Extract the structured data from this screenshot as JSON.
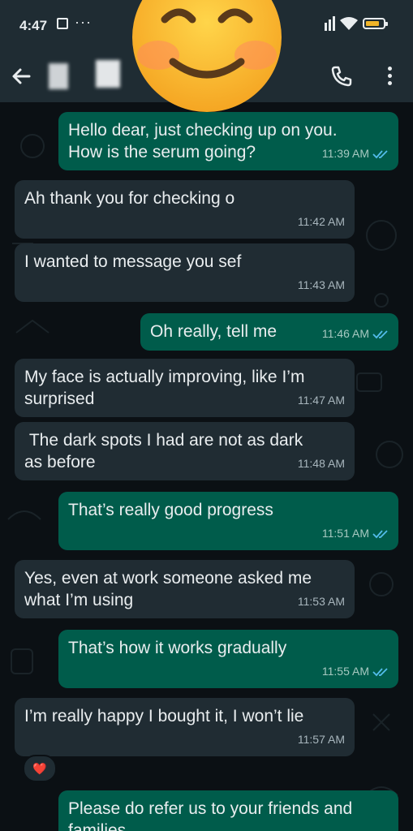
{
  "status_bar": {
    "time": "4:47",
    "dots": "···",
    "battery_level": 0.8,
    "battery_color": "#f0b429"
  },
  "header": {
    "back_icon": "arrow-left-icon",
    "call_icon": "phone-icon",
    "menu_icon": "more-vert-icon"
  },
  "colors": {
    "outgoing_bubble": "#005c4b",
    "incoming_bubble": "#202c33",
    "background": "#0b1014",
    "read_ticks": "#53bdeb"
  },
  "messages": [
    {
      "direction": "out",
      "text": "Hello dear, just checking up on you.\nHow is the serum going?",
      "time": "11:39 AM",
      "read": true
    },
    {
      "direction": "in",
      "text": "Ah thank you for checking o",
      "time": "11:42 AM"
    },
    {
      "direction": "in",
      "text": "I wanted to message you sef",
      "time": "11:43 AM"
    },
    {
      "direction": "out",
      "text": "Oh really, tell me",
      "time": "11:46 AM",
      "read": true
    },
    {
      "direction": "in",
      "text": "My face is actually improving, like I’m\nsurprised",
      "time": "11:47 AM"
    },
    {
      "direction": "in",
      "text": " The dark spots I had are not as dark\nas before",
      "time": "11:48 AM"
    },
    {
      "direction": "out",
      "text": "That’s really good progress",
      "time": "11:51 AM",
      "read": true
    },
    {
      "direction": "in",
      "text": "Yes, even at work someone asked me\nwhat I’m using",
      "time": "11:53 AM"
    },
    {
      "direction": "out",
      "text": "That’s how it works gradually",
      "time": "11:55 AM",
      "read": true
    },
    {
      "direction": "in",
      "text": "I’m really happy I bought it, I won’t lie",
      "time": "11:57 AM",
      "reaction": "❤️"
    },
    {
      "direction": "out",
      "text": "Please do refer us to your friends and\nfamilies",
      "time": ""
    }
  ]
}
